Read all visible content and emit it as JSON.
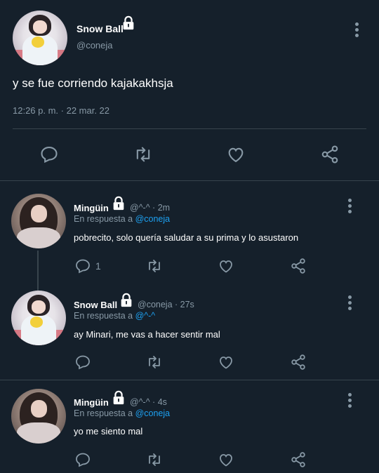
{
  "main_tweet": {
    "name": "Snow Ball",
    "handle": "@coneja",
    "text": "y se fue corriendo kajakakhsja",
    "timestamp": "12:26 p. m. · 22 mar. 22"
  },
  "replies": [
    {
      "name": "Mingüin",
      "meta": "@^-^ · 2m",
      "reply_prefix": "En respuesta a",
      "reply_to": "@coneja",
      "text": "pobrecito, solo quería saludar a su prima y lo asustaron",
      "reply_count": "1"
    },
    {
      "name": "Snow Ball",
      "meta": "@coneja · 27s",
      "reply_prefix": "En respuesta a",
      "reply_to": "@^-^",
      "text": "ay Minari, me vas a hacer sentir mal",
      "reply_count": ""
    },
    {
      "name": "Mingüin",
      "meta": "@^-^ · 4s",
      "reply_prefix": "En respuesta a",
      "reply_to": "@coneja",
      "text": "yo me siento mal",
      "reply_count": ""
    }
  ],
  "colors": {
    "background": "#15202b",
    "muted": "#8899a6",
    "link": "#1da1f2",
    "divider": "#38444d"
  }
}
